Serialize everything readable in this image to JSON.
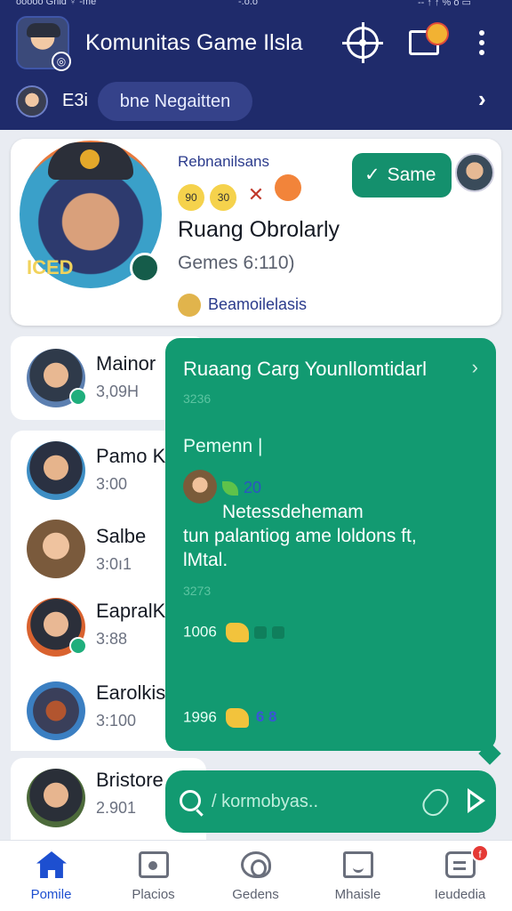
{
  "status_bar": {
    "left": "ooooo Gnid ♀ -me",
    "center": "-.o.o",
    "right": "-- ↑ ↑ % o ▭"
  },
  "header": {
    "title": "Komunitas Game Ilsla",
    "sub_label": "E3i",
    "sub_pill": "bne Negaitten",
    "sub_chevron": "›",
    "icons": [
      "target-icon",
      "cast-icon",
      "more-vert-icon"
    ]
  },
  "featured": {
    "top_text": "Rebnanilsans",
    "emojis": [
      "90",
      "30",
      "✕",
      ""
    ],
    "button_label": "Same",
    "button_check": "✓",
    "title": "Ruang Obrolarly",
    "subtitle": "Gemes 6:110)",
    "footer": "Beamoilelasis",
    "avatar_tag": "ICED"
  },
  "chats": [
    {
      "name": "Mainor",
      "time": "3,09H",
      "online": true
    },
    {
      "name": "Pamo K",
      "time": "3:00",
      "online": false
    },
    {
      "name": "Salbe",
      "time": "3:0ı1",
      "online": false
    },
    {
      "name": "EapralK",
      "time": "3:88",
      "online": true
    },
    {
      "name": "Earolkis",
      "time": "3:100",
      "online": false
    },
    {
      "name": "Bristore",
      "time": "2.901",
      "online": false
    }
  ],
  "panel": {
    "title": "Ruaang Carg Younllomtidarl",
    "chevron": "›",
    "faint1": "3236",
    "name": "Pemenn |",
    "avatar_meta": "20",
    "message_line1": "Netessdehemam",
    "message_line2": "tun palantiog ame loldons ft,",
    "message_line3": "lMtal.",
    "faint2": "3273",
    "row1": "1006",
    "row2": "1996",
    "row2_extra": "6 8"
  },
  "composer": {
    "placeholder": "/ kormobyas.."
  },
  "bottom_nav": [
    {
      "label": "Pomile",
      "icon": "home-icon",
      "active": true
    },
    {
      "label": "Placios",
      "icon": "photo-icon",
      "active": false
    },
    {
      "label": "Gedens",
      "icon": "ear-icon",
      "active": false
    },
    {
      "label": "Mhaisle",
      "icon": "clipboard-icon",
      "active": false
    },
    {
      "label": "Ieudedia",
      "icon": "message-icon",
      "active": false,
      "badge": "f"
    }
  ],
  "colors": {
    "header": "#1f2b6b",
    "accent_green": "#129a71",
    "active_blue": "#1d4fd0",
    "badge_red": "#e53935"
  }
}
